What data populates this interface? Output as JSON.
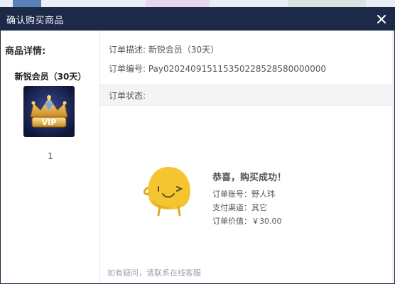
{
  "dialog": {
    "title": "确认购买商品",
    "close_glyph": "✕"
  },
  "product": {
    "details_label": "商品详情:",
    "name": "新锐会员（30天）",
    "image_icon": "vip-crown-icon",
    "image_text": "VIP",
    "quantity": "1"
  },
  "order": {
    "description": "订单描述: 新锐会员（30天）",
    "number": "订单编号: Pay020240915115350228528580000000",
    "status_label": "订单状态:"
  },
  "result": {
    "headline": "恭喜，购买成功！",
    "account": "订单账号：野人玮",
    "channel": "支付渠道：其它",
    "amount": "订单价值：￥30.00"
  },
  "footer": {
    "help_text": "如有疑问，请联系在线客服"
  },
  "colors": {
    "titlebar": "#1c2a48",
    "mascot": "#f5c431",
    "status_bar": "#f3f4f6"
  }
}
